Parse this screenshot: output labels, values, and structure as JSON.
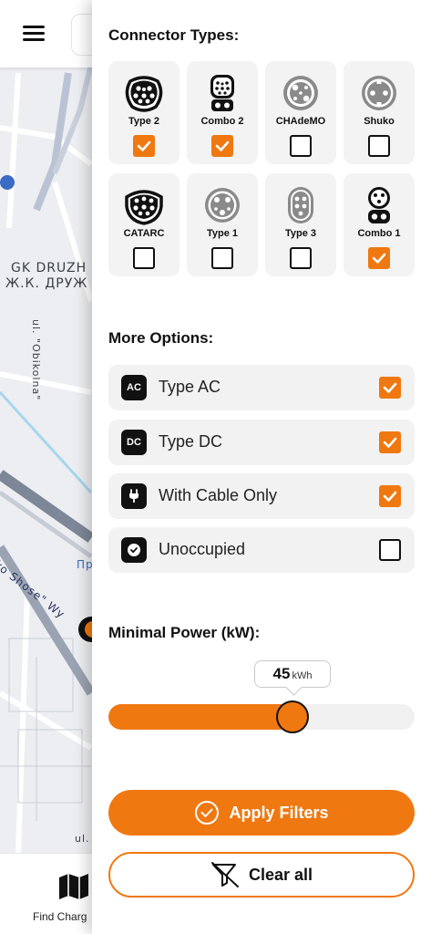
{
  "map": {
    "district_label_latin": "GK DRUZH",
    "district_label_cyrillic": "Ж.К. ДРУЖ",
    "street_label_1": "ul. \"Obikolna\"",
    "street_label_2": "ko Shose\" Wy",
    "street_label_3": "ul.",
    "poi_label": "Пр"
  },
  "top_bar": {
    "menu_icon": "hamburger-menu-icon"
  },
  "bottom_nav": {
    "find_label": "Find Charg",
    "find_icon": "map-icon"
  },
  "filters": {
    "connectors_title": "Connector Types:",
    "connectors": [
      {
        "label": "Type 2",
        "icon": "type2-connector-icon",
        "checked": true
      },
      {
        "label": "Combo 2",
        "icon": "combo2-connector-icon",
        "checked": true
      },
      {
        "label": "CHAdeMO",
        "icon": "chademo-connector-icon",
        "checked": false
      },
      {
        "label": "Shuko",
        "icon": "shuko-connector-icon",
        "checked": false
      },
      {
        "label": "CATARC",
        "icon": "catarc-connector-icon",
        "checked": false
      },
      {
        "label": "Type 1",
        "icon": "type1-connector-icon",
        "checked": false
      },
      {
        "label": "Type 3",
        "icon": "type3-connector-icon",
        "checked": false
      },
      {
        "label": "Combo 1",
        "icon": "combo1-connector-icon",
        "checked": true
      }
    ],
    "options_title": "More Options:",
    "options": [
      {
        "badge": "AC",
        "label": "Type AC",
        "checked": true
      },
      {
        "badge": "DC",
        "label": "Type DC",
        "checked": true
      },
      {
        "badge_icon": "plug-icon",
        "label": "With Cable Only",
        "checked": true
      },
      {
        "badge_icon": "check-circle-icon",
        "label": "Unoccupied",
        "checked": false
      }
    ],
    "power_title": "Minimal Power (kW):",
    "power": {
      "value": "45",
      "unit": "kWh",
      "fraction": 0.6
    },
    "apply_label": "Apply Filters",
    "clear_label": "Clear all"
  },
  "colors": {
    "accent": "#f07810",
    "dark": "#111111",
    "card_bg": "#f3f3f3"
  }
}
